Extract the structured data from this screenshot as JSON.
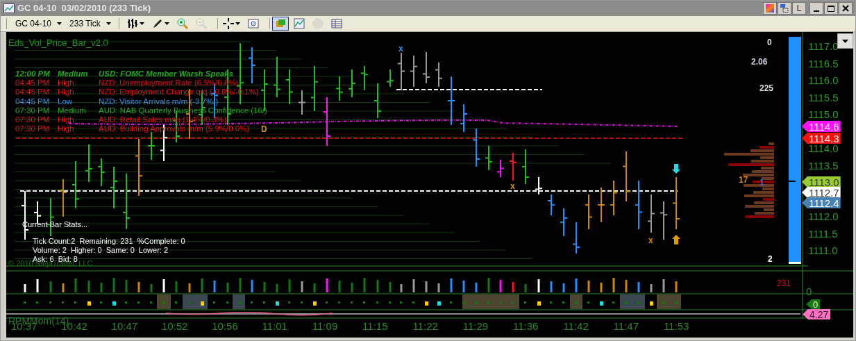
{
  "window": {
    "title": "GC 04-10  03/02/2010 (233 Tick)",
    "title_buttons": [
      {
        "kind": "color"
      },
      {
        "kind": "layout"
      },
      {
        "kind": "letter",
        "label": "L"
      },
      {
        "kind": "minimize"
      },
      {
        "kind": "maximize"
      },
      {
        "kind": "close"
      }
    ]
  },
  "toolbar": {
    "instrument": "GC 04-10",
    "period": "233 Tick",
    "tools": [
      {
        "kind": "bars",
        "selected": false,
        "disabled": false
      },
      {
        "kind": "pen",
        "selected": false,
        "disabled": false
      },
      {
        "kind": "zoom-in",
        "selected": false,
        "disabled": false
      },
      {
        "kind": "zoom-out",
        "selected": false,
        "disabled": true
      },
      {
        "kind": "crosshair",
        "selected": false,
        "disabled": false
      },
      {
        "kind": "zoom-box",
        "selected": false,
        "disabled": false
      },
      {
        "kind": "data-box",
        "selected": true,
        "disabled": false
      },
      {
        "kind": "chart",
        "selected": false,
        "disabled": false
      },
      {
        "kind": "dollar",
        "selected": false,
        "disabled": true
      },
      {
        "kind": "table",
        "selected": false,
        "disabled": false
      }
    ]
  },
  "chart": {
    "indicator_title": "Eds_Vol_Price_Bar_v2.0",
    "news": [
      {
        "time": "12:00 PM",
        "impact": "Medium",
        "event": "USD: FOMC Member Warsh Speaks",
        "color": "#22aa22",
        "upcoming": true
      },
      {
        "time": "04:45 PM",
        "impact": "High",
        "event": "NZD: Unemployment Rate (6.5%/6.8%)",
        "color": "#ee1111",
        "upcoming": false
      },
      {
        "time": "04:45 PM",
        "impact": "High",
        "event": "NZD: Employment Change q/q (-0.8%/-0.1%)",
        "color": "#ee1111",
        "upcoming": false
      },
      {
        "time": "04:45 PM",
        "impact": "Low",
        "event": "NZD: Visitor Arrivals m/m (-3.7%/)",
        "color": "#3a8ee6",
        "upcoming": false
      },
      {
        "time": "07:30 PM",
        "impact": "Medium",
        "event": "AUD: NAB Quarterly Business Confidence (16/)",
        "color": "#22aa22",
        "upcoming": false
      },
      {
        "time": "07:30 PM",
        "impact": "High",
        "event": "AUD: Retail Sales m/m (1.4%/0.3%)",
        "color": "#ee1111",
        "upcoming": false
      },
      {
        "time": "07:30 PM",
        "impact": "High",
        "event": "AUD: Building Approvals m/m (5.9%/0.0%)",
        "color": "#ee1111",
        "upcoming": false
      }
    ],
    "bar_marks": [
      {
        "text": "x",
        "color": "#3a8ee6"
      },
      {
        "text": "D",
        "color": "#cc9900"
      },
      {
        "text": "x",
        "color": "#dd8800"
      },
      {
        "text": "x",
        "color": "#dd8800"
      }
    ],
    "stats_title": "Current Bar Stats...",
    "stats_lines": [
      "Tick Count:2  Remaining: 231  %Complete: 0",
      "Volume: 2  Higher: 0  Same: 0  Lower: 2",
      "Ask: 6  Bid: 8"
    ],
    "copyright": "© 2010 NinjaTrader, LLC",
    "right_readings": [
      "0",
      "2.06",
      "225",
      "17",
      "1",
      "2"
    ],
    "price_axis": [
      "1117.0",
      "1116.5",
      "1116.0",
      "1115.5",
      "1115.0",
      "1114.0",
      "1113.5",
      "1112.0",
      "1111.5",
      "1111.0"
    ],
    "price_markers": [
      {
        "value": "1114.6",
        "color": "#ff10ff"
      },
      {
        "value": "1114.3",
        "color": "#ff1010"
      },
      {
        "value": "1113.0",
        "color": "#9acd32"
      },
      {
        "value": "1112.7",
        "color": "#ffffff"
      },
      {
        "value": "1112.4",
        "color": "#4682b4"
      }
    ],
    "volume_count": "231",
    "volume_axis": "0",
    "indicator_marker": "0",
    "momentum_label": "RPMMom(14)",
    "momentum_marker": "4.27",
    "time_axis": [
      "10:37",
      "10:42",
      "10:47",
      "10:52",
      "10:56",
      "11:01",
      "11:09",
      "11:15",
      "11:22",
      "11:29",
      "11:36",
      "11:42",
      "11:47",
      "11:53"
    ]
  }
}
